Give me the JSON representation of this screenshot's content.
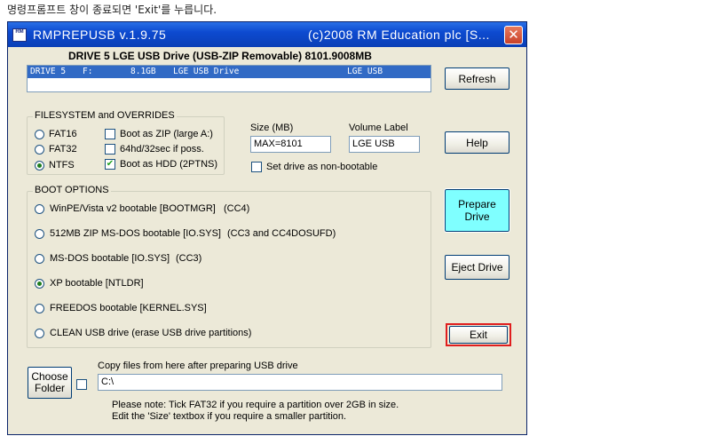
{
  "caption": "명령프롬프트 창이 종료되면 'Exit'를 누릅니다.",
  "window": {
    "title": "RMPREPUSB v.1.9.75",
    "title_right": "(c)2008 RM Education plc  [S...",
    "icon_text": "RM",
    "close_glyph": "✕"
  },
  "drive": {
    "heading": "DRIVE 5 LGE USB Drive  (USB-ZIP Removable) 8101.9008MB",
    "row": {
      "drive": "DRIVE 5",
      "letter": "F:",
      "size": "8.1GB",
      "name": "LGE USB Drive",
      "label": "LGE USB"
    }
  },
  "buttons": {
    "refresh": "Refresh",
    "help": "Help",
    "prepare": "Prepare Drive",
    "eject": "Eject Drive",
    "exit": "Exit",
    "choose_folder_line1": "Choose",
    "choose_folder_line2": "Folder"
  },
  "filesystem": {
    "legend": "FILESYSTEM and OVERRIDES",
    "fs_options": [
      {
        "label": "FAT16",
        "selected": false
      },
      {
        "label": "FAT32",
        "selected": false
      },
      {
        "label": "NTFS",
        "selected": true
      }
    ],
    "overrides": [
      {
        "label": "Boot as ZIP (large A:)",
        "checked": false
      },
      {
        "label": "64hd/32sec if poss.",
        "checked": false
      },
      {
        "label": "Boot as HDD (2PTNS)",
        "checked": true
      }
    ]
  },
  "size": {
    "label": "Size (MB)",
    "value": "MAX=8101"
  },
  "volume": {
    "label": "Volume Label",
    "value": "LGE USB"
  },
  "non_bootable": {
    "label": "Set drive as non-bootable",
    "checked": false
  },
  "boot": {
    "legend": "BOOT OPTIONS",
    "options": [
      {
        "label": "WinPE/Vista v2 bootable [BOOTMGR]",
        "note": "(CC4)",
        "selected": false
      },
      {
        "label": "512MB ZIP MS-DOS bootable [IO.SYS]",
        "note": "(CC3 and CC4DOSUFD)",
        "selected": false
      },
      {
        "label": "MS-DOS bootable [IO.SYS]",
        "note": "(CC3)",
        "selected": false
      },
      {
        "label": "XP bootable [NTLDR]",
        "note": "",
        "selected": true
      },
      {
        "label": "FREEDOS bootable [KERNEL.SYS]",
        "note": "",
        "selected": false
      },
      {
        "label": "CLEAN USB drive (erase USB drive partitions)",
        "note": "",
        "selected": false
      }
    ]
  },
  "copy": {
    "label": "Copy files from here after preparing USB drive",
    "path": "C:\\",
    "checked": false
  },
  "note": {
    "line1": "Please note: Tick FAT32 if you require a partition over 2GB in size.",
    "line2": "Edit the 'Size' textbox if you require a smaller partition."
  },
  "colors": {
    "titlebar": "#0d4ad0",
    "window_bg": "#ece9d8",
    "selection": "#316ac5",
    "prepare_bg": "#7fffff",
    "highlight": "#e01e1e"
  }
}
